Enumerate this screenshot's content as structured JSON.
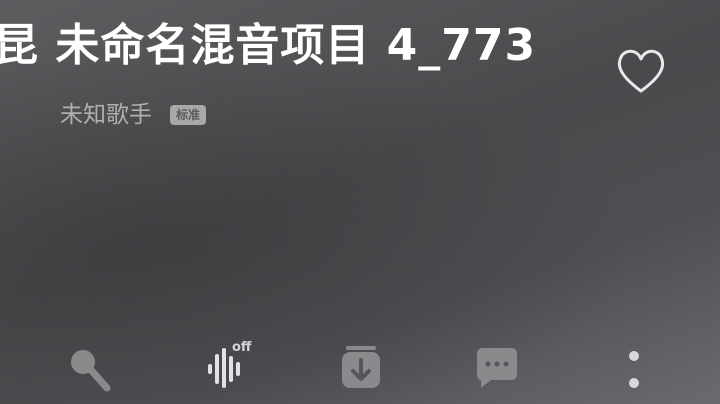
{
  "song": {
    "title": "昆 未命名混音项目 4_773",
    "artist": "未知歌手",
    "quality_badge": "标准"
  },
  "toolbar": {
    "effect_state": "off"
  },
  "icons": {
    "favorite": "heart-outline-icon",
    "karaoke": "microphone-icon",
    "sound_effect": "sound-wave-icon",
    "download": "download-icon",
    "comments": "comment-bubble-icon",
    "more": "more-vertical-icon"
  },
  "colors": {
    "title": "#ffffff",
    "subtitle": "#b0b0b3",
    "icon": "#8a8a8d"
  }
}
